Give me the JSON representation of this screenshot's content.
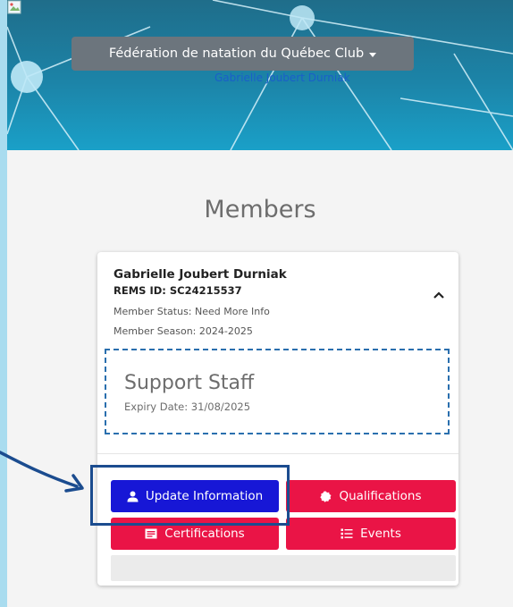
{
  "header": {
    "club_selector": "Fédération de natation du Québec Club",
    "user_link": "Gabrielle Joubert Durniak"
  },
  "page": {
    "title": "Members"
  },
  "member": {
    "name": "Gabrielle Joubert Durniak",
    "rems_id": "REMS ID: SC24215537",
    "status": "Member Status: Need More Info",
    "season": "Member Season: 2024-2025"
  },
  "role": {
    "title": "Support Staff",
    "expiry": "Expiry Date: 31/08/2025"
  },
  "actions": {
    "update_information": "Update Information",
    "qualifications": "Qualifications",
    "certifications": "Certifications",
    "events": "Events"
  },
  "colors": {
    "primary_button": "#1717d6",
    "danger_button": "#ea1446",
    "annotation": "#1b4c8f",
    "banner": "#1c84a8"
  },
  "icons": {
    "update_information": "user-icon",
    "qualifications": "badge-icon",
    "certifications": "id-card-icon",
    "events": "list-icon",
    "collapse": "chevron-up-icon"
  }
}
